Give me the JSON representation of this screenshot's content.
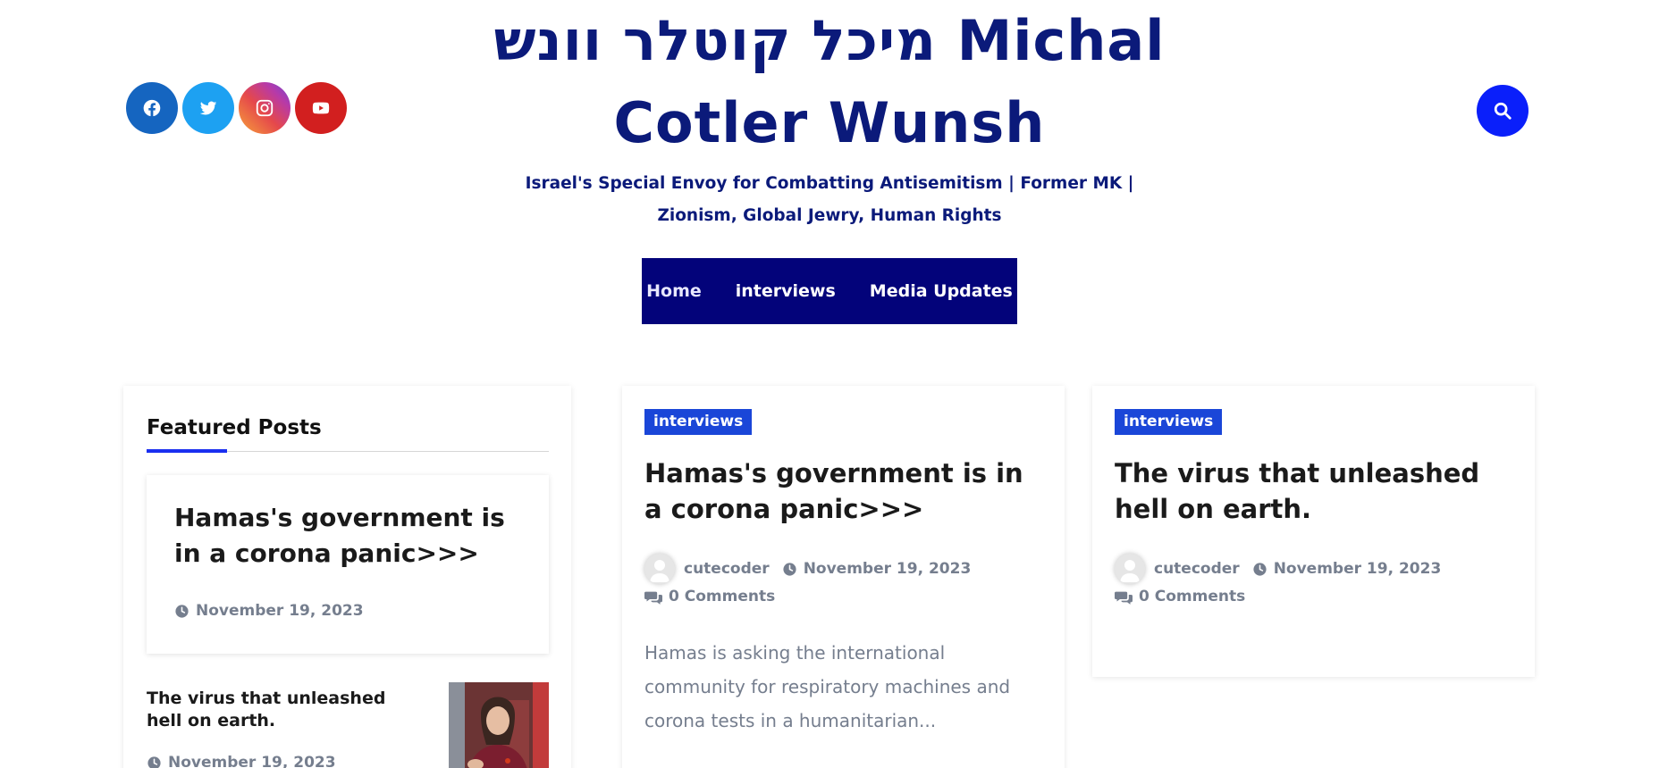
{
  "header": {
    "site_title_line1": "מיכל קוטלר וונש Michal",
    "site_title_line2": "Cotler Wunsh",
    "tagline": "Israel's Special Envoy for Combatting Antisemitism | Former MK | Zionism, Global Jewry, Human Rights",
    "social_icons": [
      "facebook-icon",
      "twitter-icon",
      "instagram-icon",
      "youtube-icon"
    ],
    "search_icon": "search-icon"
  },
  "nav": {
    "items": [
      {
        "label": "Home"
      },
      {
        "label": "interviews"
      },
      {
        "label": "Media Updates"
      }
    ]
  },
  "featured": {
    "widget_title": "Featured Posts",
    "main_post": {
      "title": "Hamas's government is in a corona panic>>>",
      "date": "November 19, 2023"
    },
    "mini_post": {
      "title": "The virus that unleashed hell on earth.",
      "date": "November 19, 2023"
    }
  },
  "posts": [
    {
      "category": "interviews",
      "title": "Hamas's government is in a corona panic>>>",
      "author": "cutecoder",
      "date": "November 19, 2023",
      "comments": "0 Comments",
      "excerpt": "Hamas is asking the international community for respiratory machines and corona tests in a humanitarian..."
    },
    {
      "category": "interviews",
      "title": "The virus that unleashed hell on earth.",
      "author": "cutecoder",
      "date": "November 19, 2023",
      "comments": "0 Comments"
    }
  ],
  "colors": {
    "brand_navy": "#0b1a7a",
    "nav_bg": "#03037a",
    "accent_blue": "#1a46d8",
    "search_blue": "#0a1ffa"
  }
}
